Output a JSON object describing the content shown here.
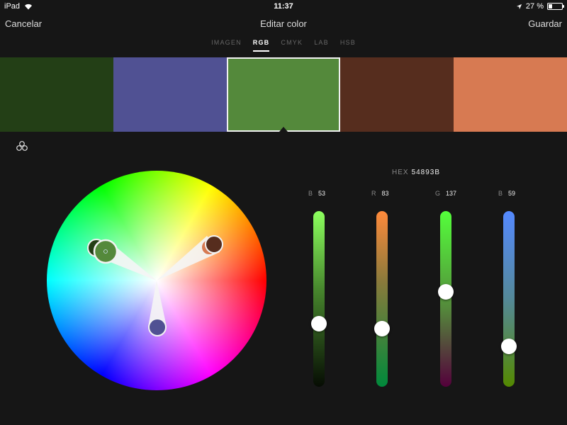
{
  "status_bar": {
    "device": "iPad",
    "time": "11:37",
    "battery": "27 %",
    "battery_level": 0.27
  },
  "nav": {
    "cancel_label": "Cancelar",
    "title": "Editar color",
    "save_label": "Guardar"
  },
  "tabs": [
    {
      "label": "IMAGEN",
      "active": false
    },
    {
      "label": "RGB",
      "active": true
    },
    {
      "label": "CMYK",
      "active": false
    },
    {
      "label": "LAB",
      "active": false
    },
    {
      "label": "HSB",
      "active": false
    }
  ],
  "swatches": [
    {
      "color": "#233f16",
      "selected": false
    },
    {
      "color": "#505193",
      "selected": false
    },
    {
      "color": "#54893b",
      "selected": true
    },
    {
      "color": "#562d1e",
      "selected": false
    },
    {
      "color": "#d77a52",
      "selected": false
    }
  ],
  "hex": {
    "label": "HEX",
    "value": "54893B"
  },
  "sliders": [
    {
      "label": "B",
      "value": "53",
      "level": 0.36,
      "gradient": "linear-gradient(to bottom, #8cff5e, #47862d 45%, #060c03)"
    },
    {
      "label": "R",
      "value": "83",
      "level": 0.33,
      "gradient": "linear-gradient(to bottom, #ff8a3b, #8a7a3b 40%, #00893b)"
    },
    {
      "label": "G",
      "value": "137",
      "level": 0.54,
      "gradient": "linear-gradient(to bottom, #54ff3b, #548a3b 55%, #54003b 100%)"
    },
    {
      "label": "B",
      "value": "59",
      "level": 0.23,
      "gradient": "linear-gradient(to bottom, #5489ff, #548999 50%, #548900)"
    }
  ]
}
